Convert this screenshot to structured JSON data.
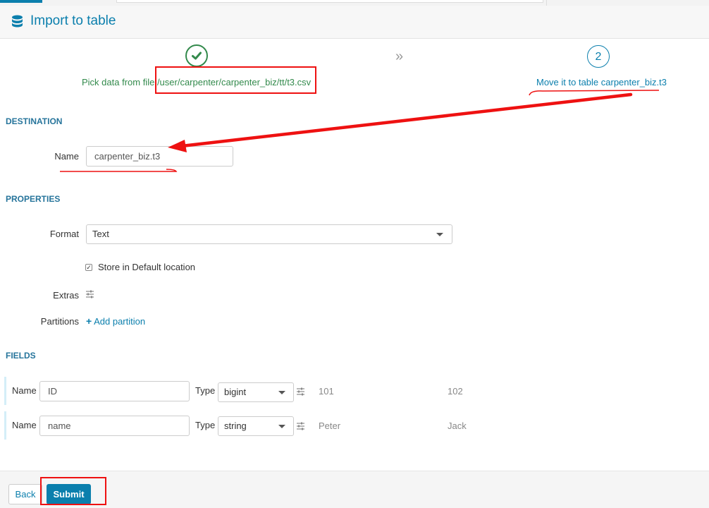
{
  "header": {
    "title": "Import to table",
    "icon": "database-icon"
  },
  "steps": [
    {
      "label_prefix": "Pick data from file ",
      "path": "/user/carpenter/carpenter_biz/tt/t3.csv",
      "state": "done",
      "icon": "check-icon"
    },
    {
      "number": "2",
      "label": "Move it to table carpenter_biz.t3",
      "state": "current"
    }
  ],
  "destination": {
    "section": "DESTINATION",
    "name_label": "Name",
    "name_value": "carpenter_biz.t3"
  },
  "properties": {
    "section": "PROPERTIES",
    "format_label": "Format",
    "format_value": "Text",
    "store_default_label": "Store in Default location",
    "store_default_checked": true,
    "extras_label": "Extras",
    "partitions_label": "Partitions",
    "add_partition_label": "Add partition"
  },
  "fields": {
    "section": "FIELDS",
    "rows": [
      {
        "name_label": "Name",
        "name_value": "ID",
        "type_label": "Type",
        "type_value": "bigint",
        "samples": [
          "101",
          "102"
        ]
      },
      {
        "name_label": "Name",
        "name_value": "name",
        "type_label": "Type",
        "type_value": "string",
        "samples": [
          "Peter",
          "Jack"
        ]
      }
    ]
  },
  "footer": {
    "back_label": "Back",
    "submit_label": "Submit"
  },
  "colors": {
    "accent": "#0b7fad",
    "success": "#338a4c",
    "annotation": "#ee1111"
  }
}
